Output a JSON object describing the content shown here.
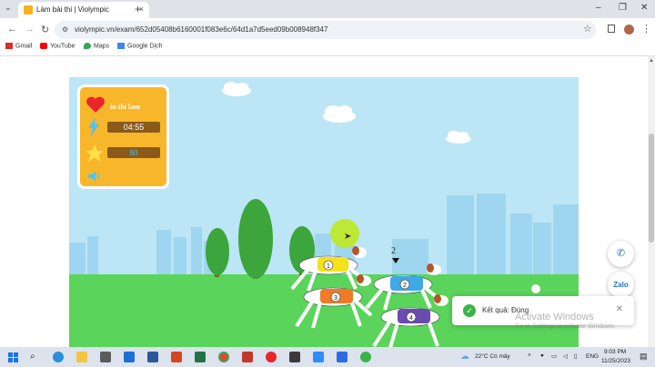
{
  "browser": {
    "tab_title": "Làm bài thi | Violympic",
    "url": "violympic.vn/exam/652d05408b6160001f083e6c/64d1a7d5eed09b008948f347",
    "tab_close": "×",
    "new_tab": "+",
    "tab_menu": "⌄",
    "minimize": "–",
    "maximize": "❐",
    "close": "✕",
    "back": "←",
    "forward": "→",
    "reload": "↻",
    "star": "☆",
    "more": "⋮",
    "tune": "⚙"
  },
  "bookmarks": [
    {
      "label": "Gmail",
      "color": "#d93025"
    },
    {
      "label": "YouTube",
      "color": "#ff0000"
    },
    {
      "label": "Maps",
      "color": "#34a853"
    },
    {
      "label": "Google Dịch",
      "color": "#4285f4"
    }
  ],
  "game": {
    "player_name": "in thi lam",
    "timer": "04:55",
    "score": "80",
    "marker_number": "2",
    "colors": {
      "sky": "#bce6f5",
      "ground": "#5ad45a",
      "panel": "#f8b62a",
      "dog1_shirt": "#f6e21a",
      "dog2_shirt": "#3fa9e6",
      "dog3_shirt": "#f07a28",
      "dog4_shirt": "#6a4bb0"
    },
    "dogs": [
      {
        "lane": "1"
      },
      {
        "lane": "2"
      },
      {
        "lane": "3"
      },
      {
        "lane": "4"
      }
    ]
  },
  "widgets": {
    "call_icon": "✆",
    "zalo_label": "Zalo"
  },
  "toast": {
    "message": "Kết quả: Đúng",
    "check": "✓",
    "close": "✕"
  },
  "watermark": {
    "line1": "Activate Windows",
    "line2": "Go to Settings to activate Windows."
  },
  "taskbar": {
    "weather": "22°C  Có mây",
    "language": "ENG",
    "time": "9:03 PM",
    "date": "11/25/2023"
  }
}
